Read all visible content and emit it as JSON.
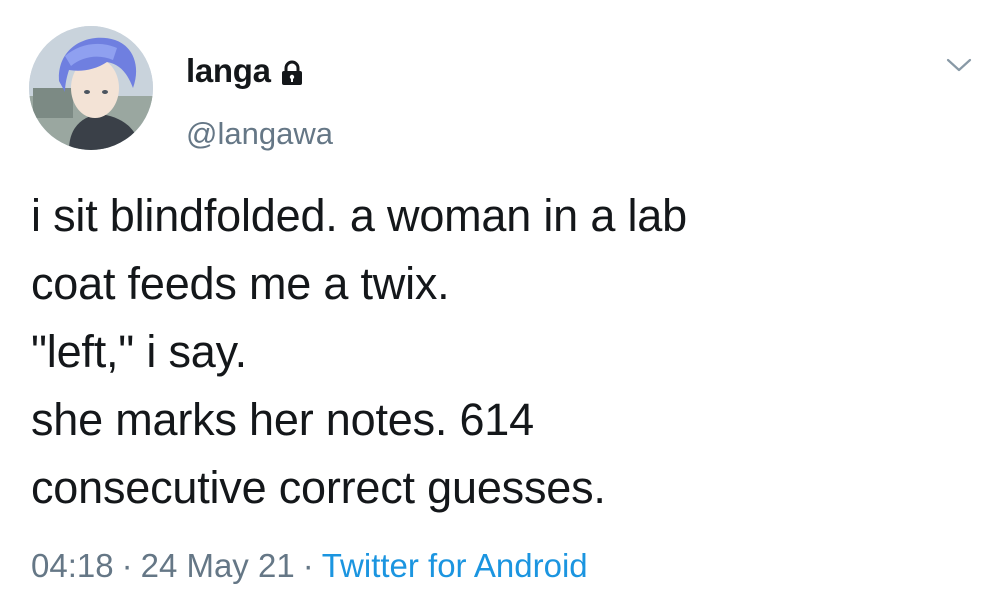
{
  "tweet": {
    "author": {
      "display_name": "langa",
      "handle": "@langawa",
      "protected_icon": "lock-icon",
      "avatar": "anime-avatar"
    },
    "menu_icon": "chevron-down-icon",
    "text_lines": [
      "i sit blindfolded. a woman in a lab",
      "coat feeds me a twix.",
      "\"left,\" i say.",
      "she marks her notes. 614",
      "consecutive correct guesses."
    ],
    "time": "04:18",
    "date": "24 May 21",
    "separator": "·",
    "source": "Twitter for Android"
  },
  "colors": {
    "text": "#14171a",
    "secondary": "#657786",
    "link": "#1b95e0"
  }
}
